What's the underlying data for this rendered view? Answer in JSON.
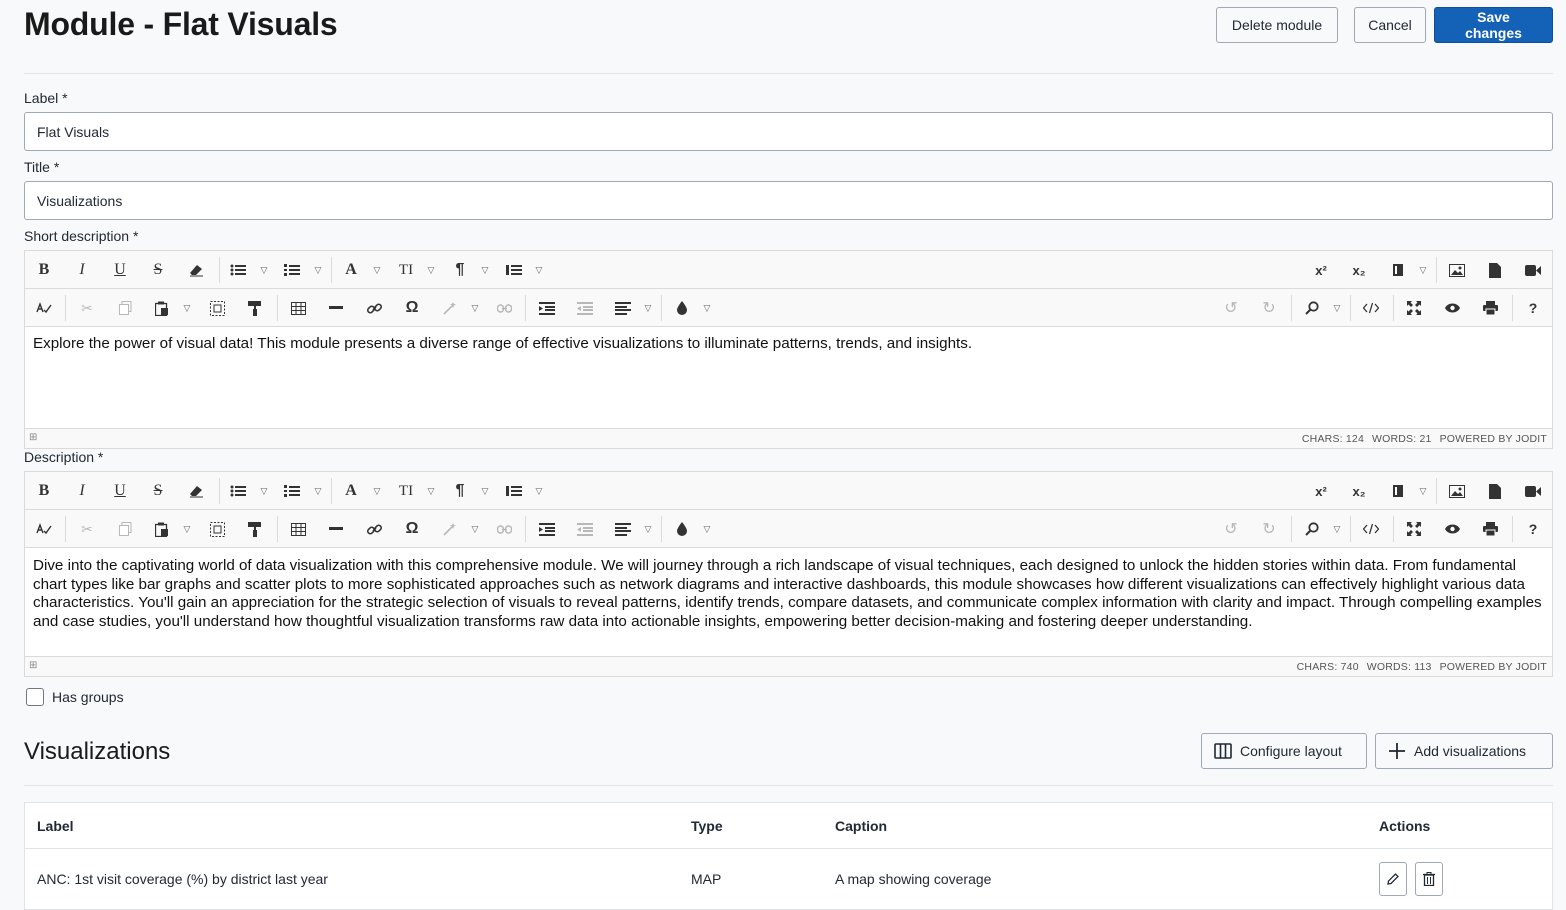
{
  "header": {
    "title": "Module - Flat Visuals",
    "delete_label": "Delete module",
    "cancel_label": "Cancel",
    "save_label": "Save changes"
  },
  "form": {
    "label_field": {
      "label": "Label *",
      "value": "Flat Visuals"
    },
    "title_field": {
      "label": "Title *",
      "value": "Visualizations"
    },
    "short_description": {
      "label": "Short description *",
      "content": "Explore the power of visual data! This module presents a diverse range of effective visualizations to illuminate patterns, trends, and insights.",
      "chars": "CHARS: 124",
      "words": "WORDS: 21",
      "powered": "POWERED BY JODIT"
    },
    "description": {
      "label": "Description *",
      "content": "Dive into the captivating world of data visualization with this comprehensive module. We will journey through a rich landscape of visual techniques, each designed to unlock the hidden stories within data. From fundamental chart types like bar graphs and scatter plots to more sophisticated approaches such as network diagrams and interactive dashboards, this module showcases how different visualizations can effectively highlight various data characteristics. You'll gain an appreciation for the strategic selection of visuals to reveal patterns, identify trends, compare datasets, and communicate complex information with clarity and impact. Through compelling examples and case studies, you'll understand how thoughtful visualization transforms raw data into actionable insights, empowering better decision-making and fostering deeper understanding.",
      "chars": "CHARS: 740",
      "words": "WORDS: 113",
      "powered": "POWERED BY JODIT"
    },
    "has_groups": {
      "label": "Has groups",
      "checked": false
    }
  },
  "toolbar": {
    "bold": "B",
    "italic": "I",
    "underline": "U",
    "strike": "S",
    "font": "A",
    "font_size": "TI",
    "paragraph": "¶",
    "superscript": "x²",
    "subscript": "x₂",
    "omega": "Ω",
    "help": "?"
  },
  "visualizations": {
    "title": "Visualizations",
    "configure_label": "Configure layout",
    "add_label": "Add visualizations",
    "columns": [
      "Label",
      "Type",
      "Caption",
      "Actions"
    ],
    "rows": [
      {
        "label": "ANC: 1st visit coverage (%) by district last year",
        "type": "MAP",
        "caption": "A map showing coverage"
      }
    ]
  }
}
